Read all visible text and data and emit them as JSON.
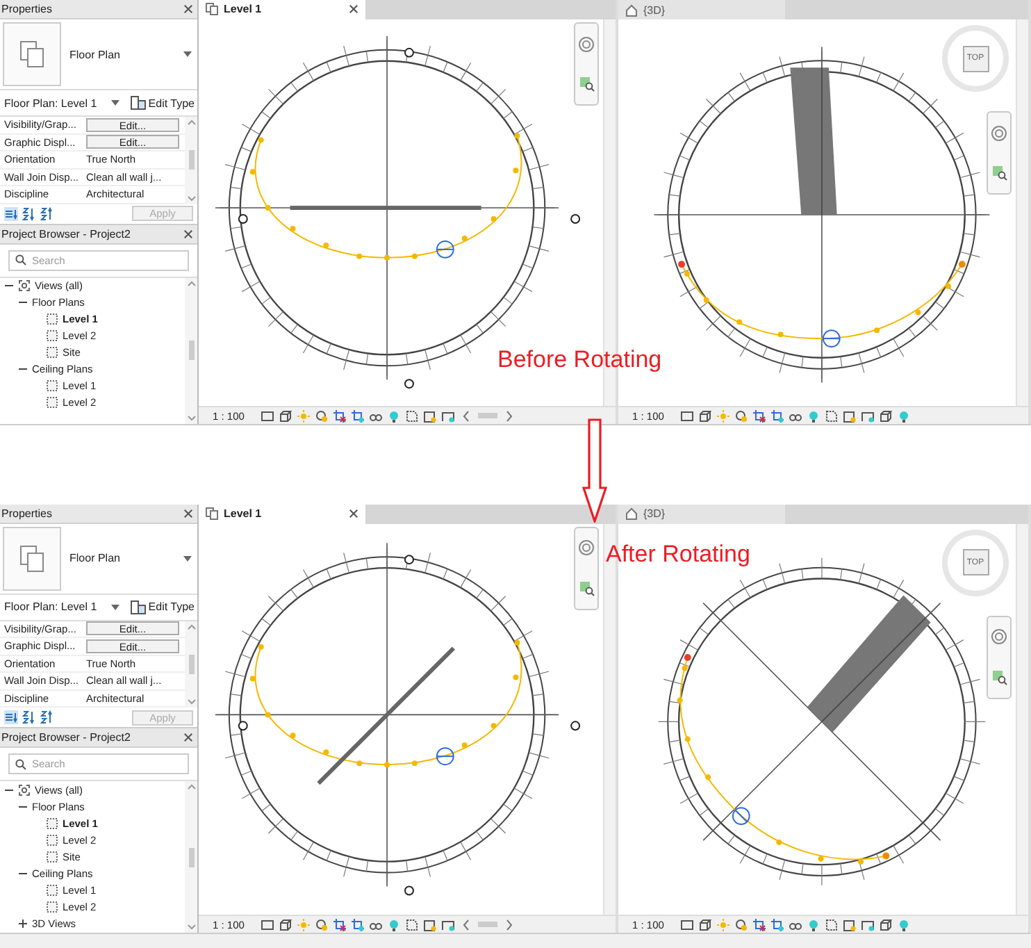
{
  "panels": [
    {
      "caption": "Before Rotating",
      "rotated": false,
      "properties": {
        "title": "Properties",
        "type_name": "Floor Plan",
        "instance": "Floor Plan: Level 1",
        "edit_type": "Edit Type",
        "apply": {
          "label": "Apply",
          "disabled": true
        },
        "rows": [
          {
            "label": "Visibility/Grap...",
            "value": "Edit...",
            "kind": "button"
          },
          {
            "label": "Graphic Displ...",
            "value": "Edit...",
            "kind": "button"
          },
          {
            "label": "Orientation",
            "value": "True North",
            "kind": "text"
          },
          {
            "label": "Wall Join Disp...",
            "value": "Clean all wall j...",
            "kind": "text"
          },
          {
            "label": "Discipline",
            "value": "Architectural",
            "kind": "text"
          }
        ]
      },
      "browser": {
        "title": "Project Browser - Project2",
        "search_placeholder": "Search",
        "tree": [
          {
            "label": "Views (all)",
            "expanded": true,
            "selected": false,
            "children": [
              {
                "label": "Floor Plans",
                "expanded": true,
                "selected": false,
                "children": [
                  {
                    "label": "Level 1",
                    "selected": true
                  },
                  {
                    "label": "Level 2",
                    "selected": false
                  },
                  {
                    "label": "Site",
                    "selected": false
                  }
                ]
              },
              {
                "label": "Ceiling Plans",
                "expanded": true,
                "selected": false,
                "children": [
                  {
                    "label": "Level 1",
                    "selected": false
                  },
                  {
                    "label": "Level 2",
                    "selected": false
                  }
                ]
              }
            ]
          }
        ]
      },
      "views": [
        {
          "title": "Level 1",
          "kind": "plan",
          "active": true,
          "scale": "1 : 100"
        },
        {
          "title": "{3D}",
          "kind": "model",
          "active": false,
          "scale": "1 : 100",
          "viewcube": "TOP"
        }
      ]
    },
    {
      "caption": "After Rotating",
      "rotated": true,
      "properties": {
        "title": "Properties",
        "type_name": "Floor Plan",
        "instance": "Floor Plan: Level 1",
        "edit_type": "Edit Type",
        "apply": {
          "label": "Apply",
          "disabled": true
        },
        "rows": [
          {
            "label": "Visibility/Grap...",
            "value": "Edit...",
            "kind": "button"
          },
          {
            "label": "Graphic Displ...",
            "value": "Edit...",
            "kind": "button"
          },
          {
            "label": "Orientation",
            "value": "True North",
            "kind": "text"
          },
          {
            "label": "Wall Join Disp...",
            "value": "Clean all wall j...",
            "kind": "text"
          },
          {
            "label": "Discipline",
            "value": "Architectural",
            "kind": "text"
          }
        ]
      },
      "browser": {
        "title": "Project Browser - Project2",
        "search_placeholder": "Search",
        "tree": [
          {
            "label": "Views (all)",
            "expanded": true,
            "selected": false,
            "children": [
              {
                "label": "Floor Plans",
                "expanded": true,
                "selected": false,
                "children": [
                  {
                    "label": "Level 1",
                    "selected": true
                  },
                  {
                    "label": "Level 2",
                    "selected": false
                  },
                  {
                    "label": "Site",
                    "selected": false
                  }
                ]
              },
              {
                "label": "Ceiling Plans",
                "expanded": true,
                "selected": false,
                "children": [
                  {
                    "label": "Level 1",
                    "selected": false
                  },
                  {
                    "label": "Level 2",
                    "selected": false
                  }
                ]
              },
              {
                "label": "3D Views",
                "expanded": false,
                "selected": false
              }
            ]
          }
        ]
      },
      "views": [
        {
          "title": "Level 1",
          "kind": "plan",
          "active": true,
          "scale": "1 : 100"
        },
        {
          "title": "{3D}",
          "kind": "model",
          "active": false,
          "scale": "1 : 100",
          "viewcube": "TOP"
        }
      ]
    }
  ]
}
